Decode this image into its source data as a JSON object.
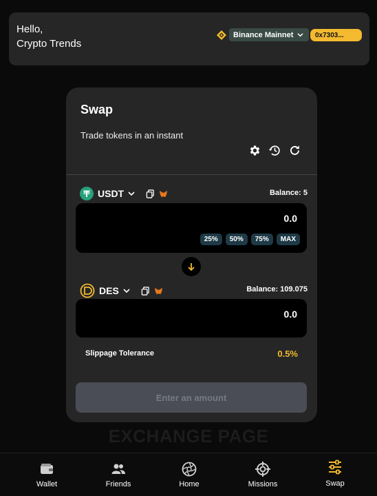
{
  "header": {
    "greeting_line1": "Hello,",
    "greeting_line2": "Crypto Trends",
    "network_icon": "bnb-icon",
    "network_label": "Binance Mainnet",
    "wallet_address": "0x7303..."
  },
  "swap": {
    "title": "Swap",
    "subtitle": "Trade tokens in an instant",
    "from": {
      "token": "USDT",
      "balance": "Balance: 5",
      "amount": "0.0",
      "percent_buttons": [
        "25%",
        "50%",
        "75%",
        "MAX"
      ]
    },
    "to": {
      "token": "DES",
      "balance": "Balance: 109.075",
      "amount": "0.0"
    },
    "slippage_label": "Slippage Tolerance",
    "slippage_value": "0.5%",
    "submit_label": "Enter an amount"
  },
  "page_label": "EXCHANGE PAGE",
  "nav": {
    "items": [
      {
        "label": "Wallet",
        "icon": "wallet-icon"
      },
      {
        "label": "Friends",
        "icon": "friends-icon"
      },
      {
        "label": "Home",
        "icon": "home-icon"
      },
      {
        "label": "Missions",
        "icon": "missions-icon"
      },
      {
        "label": "Swap",
        "icon": "swap-icon",
        "active": true
      }
    ]
  },
  "colors": {
    "accent": "#f3ba2f",
    "card": "#262626",
    "percent_chip": "#1e3a46",
    "usdt": "#26a17b"
  }
}
